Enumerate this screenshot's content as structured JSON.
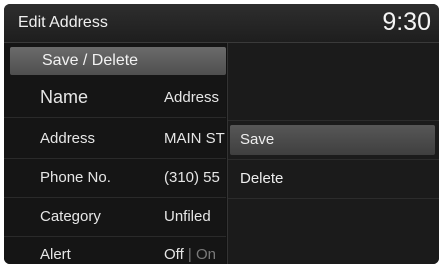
{
  "header": {
    "title": "Edit Address",
    "clock": "9:30"
  },
  "menu_button": "Save / Delete",
  "fields": [
    {
      "label": "Name",
      "value": "Address"
    },
    {
      "label": "Address",
      "value": "MAIN ST"
    },
    {
      "label": "Phone No.",
      "value": "(310) 55"
    },
    {
      "label": "Category",
      "value": "Unfiled"
    },
    {
      "label": "Alert",
      "value_on": "Off",
      "separator": "|",
      "value_off": "On"
    }
  ],
  "popup": {
    "items": [
      {
        "label": "Save",
        "selected": true
      },
      {
        "label": "Delete",
        "selected": false
      }
    ]
  },
  "colors": {
    "background": "#121212",
    "highlight": "#575757",
    "text": "#e8e8e8"
  }
}
